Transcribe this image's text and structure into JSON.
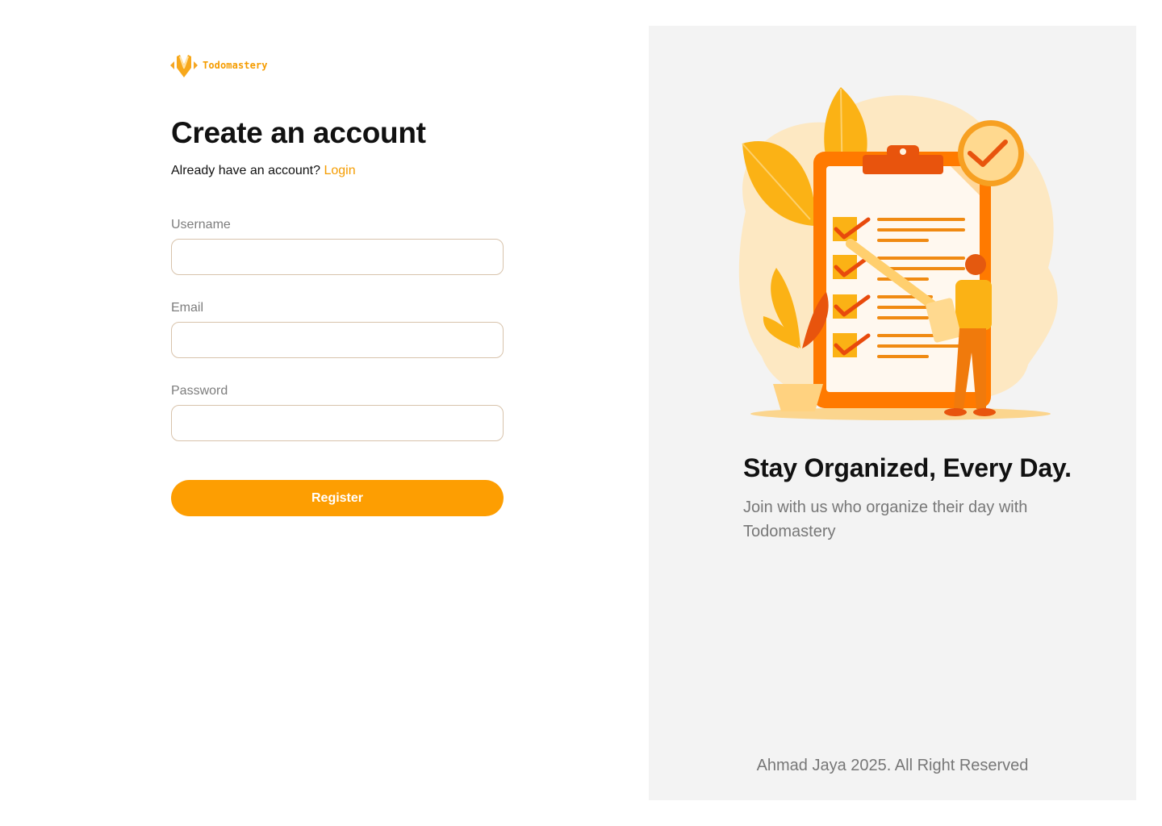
{
  "brand": {
    "name": "Todomastery",
    "accent": "#f59c00"
  },
  "form": {
    "title": "Create an account",
    "have_account": "Already have an account?",
    "login_link": "Login",
    "fields": {
      "username": {
        "label": "Username",
        "value": ""
      },
      "email": {
        "label": "Email",
        "value": ""
      },
      "password": {
        "label": "Password",
        "value": ""
      }
    },
    "submit_label": "Register",
    "submit_color": "#fd9e02"
  },
  "panel": {
    "background": "#f3f3f3",
    "illustration": "checklist-illustration",
    "tagline": "Stay Organized, Every Day.",
    "subtext": "Join with us who organize their day with Todomastery",
    "footer": "Ahmad Jaya 2025. All Right Reserved"
  }
}
